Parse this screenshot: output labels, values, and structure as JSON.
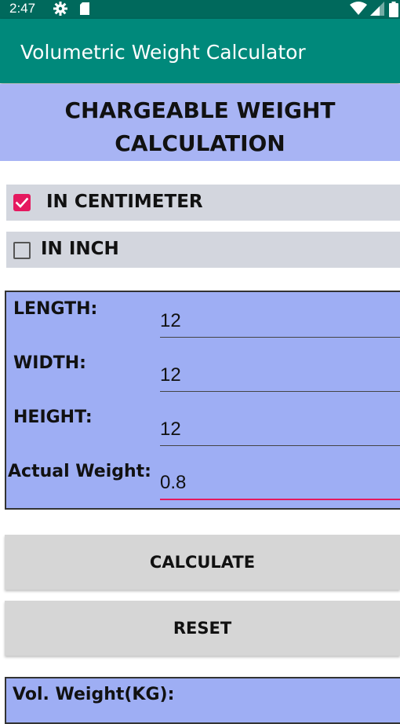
{
  "status_bar": {
    "time": "2:47",
    "icons": [
      "gear-icon",
      "sd-card-icon",
      "wifi-icon",
      "signal-icon",
      "battery-icon"
    ]
  },
  "app_bar": {
    "title": "Volumetric Weight Calculator"
  },
  "heading": {
    "line1": "CHARGEABLE WEIGHT",
    "line2": "CALCULATION"
  },
  "units": {
    "centimeter": {
      "label": "IN CENTIMETER",
      "checked": true
    },
    "inch": {
      "label": "IN INCH",
      "checked": false
    }
  },
  "form": {
    "length": {
      "label": "LENGTH:",
      "value": "12"
    },
    "width": {
      "label": "WIDTH:",
      "value": "12"
    },
    "height": {
      "label": "HEIGHT:",
      "value": "12"
    },
    "actual_weight": {
      "label": "Actual Weight:",
      "value": "0.8"
    }
  },
  "buttons": {
    "calculate": "CALCULATE",
    "reset": "RESET"
  },
  "result": {
    "vol_weight_label": "Vol. Weight(KG):"
  },
  "colors": {
    "status_bar": "#00695c",
    "app_bar": "#00897b",
    "accent": "#e5195f",
    "panel": "#9eaef4",
    "heading_band": "#a8b4f4",
    "option_row": "#d3d6de",
    "button": "#d6d6d6"
  }
}
